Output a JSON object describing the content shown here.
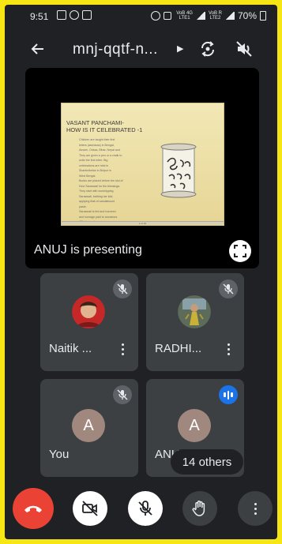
{
  "status_bar": {
    "time": "9:51",
    "network_1": "VoB 4G\nLTE1",
    "network_2": "VoB R\nLTE2",
    "battery": "70%"
  },
  "app_bar": {
    "meeting_code": "mnj-qqtf-n...",
    "icons": [
      "back-arrow-icon",
      "switch-camera-icon",
      "speaker-off-icon"
    ]
  },
  "presentation": {
    "presenter_text": "ANUJ is presenting",
    "slide": {
      "title_line1": "VASANT PANCHAMI-",
      "title_line2": "HOW IS IT CELEBRATED -1",
      "body": [
        "Children are taught their first",
        "letters (aksharas) in Bengal,",
        "Assam, Orissa, Bihar, Nepal and",
        "They are given a pen or a chalk to",
        "write the first letter. Big",
        "celebrations are held in",
        "Shantiniketan in Bolpur in",
        "West Bengal.",
        "Books are placed before the idol of",
        "Devi Saraswati for the blessings.",
        "They start with worshipping",
        "Saraswati, bathing her idol,",
        "applying tilak of sandalwood",
        "paste.",
        "Saraswati is fed and honored",
        "and homage paid to ancestors",
        "(Pitri-tarpan)."
      ],
      "footer": "1 of 16"
    }
  },
  "participants": [
    {
      "name": "Naitik ...",
      "avatar_type": "photo",
      "muted": true
    },
    {
      "name": "RADHI...",
      "avatar_type": "photo",
      "muted": true
    },
    {
      "name": "You",
      "avatar_letter": "A",
      "muted": true
    },
    {
      "name": "ANUJ",
      "avatar_letter": "A",
      "speaking": true
    }
  ],
  "others_label": "14 others",
  "controls": [
    "end-call",
    "camera-off",
    "mic-off",
    "raise-hand",
    "more-options"
  ],
  "colors": {
    "frame": "#f5e614",
    "background": "#202124",
    "tile": "#3c4043",
    "end_call": "#ea4335",
    "speaking": "#1a73e8",
    "avatar": "#a1887f"
  }
}
